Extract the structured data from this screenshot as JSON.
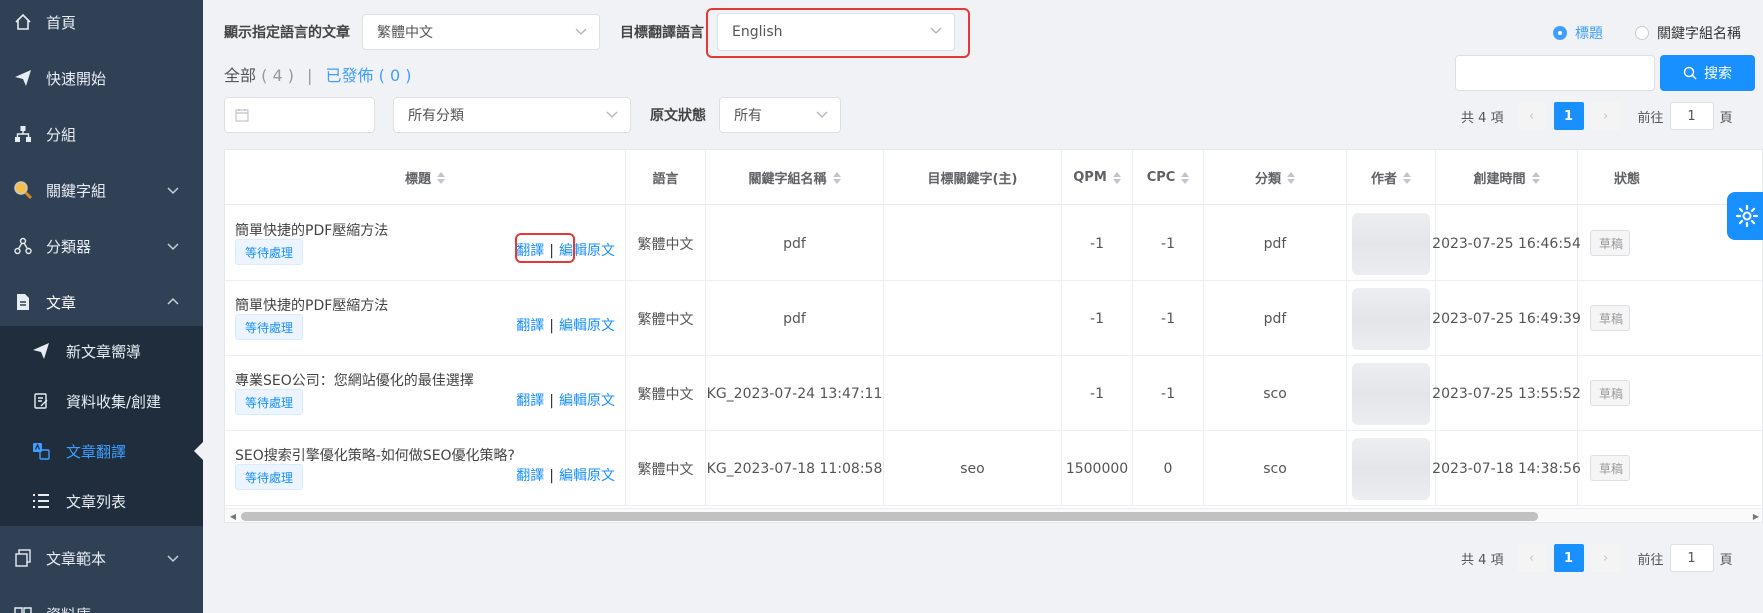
{
  "sidebar": {
    "items": [
      {
        "label": "首頁",
        "icon": "home-icon"
      },
      {
        "label": "快速開始",
        "icon": "paper-plane-icon"
      },
      {
        "label": "分組",
        "icon": "sitemap-icon"
      },
      {
        "label": "關鍵字組",
        "icon": "magnifier-icon"
      },
      {
        "label": "分類器",
        "icon": "share-nodes-icon"
      },
      {
        "label": "文章",
        "icon": "document-icon"
      },
      {
        "label": "文章範本",
        "icon": "copy-icon"
      },
      {
        "label": "資料庫",
        "icon": "book-icon"
      }
    ],
    "article_sub": [
      {
        "label": "新文章嚮導",
        "icon": "paper-plane-icon"
      },
      {
        "label": "資料收集/創建",
        "icon": "clipboard-edit-icon"
      },
      {
        "label": "文章翻譯",
        "icon": "translate-icon"
      },
      {
        "label": "文章列表",
        "icon": "list-icon"
      }
    ]
  },
  "filters": {
    "show_lang_label": "顯示指定語言的文章",
    "show_lang_value": "繁體中文",
    "target_lang_label": "目標翻譯語言",
    "target_lang_value": "English",
    "category_value": "所有分類",
    "status_label": "原文狀態",
    "status_value": "所有"
  },
  "search": {
    "radio_title": "標題",
    "radio_keyword_group": "關鍵字組名稱",
    "button": "搜索"
  },
  "counts": {
    "all_label": "全部",
    "all_count": "( 4 )",
    "divider": "|",
    "published_label": "已發佈",
    "published_count": "( 0 )"
  },
  "pagination": {
    "total": "共 4 項",
    "current": "1",
    "goto_prefix": "前往",
    "goto_value": "1",
    "goto_suffix": "頁"
  },
  "table": {
    "headers": {
      "title": "標題",
      "language": "語言",
      "keyword_group": "關鍵字組名稱",
      "target_keyword": "目標關鍵字(主)",
      "qpm": "QPM",
      "cpc": "CPC",
      "category": "分類",
      "author": "作者",
      "created": "創建時間",
      "status": "狀態"
    },
    "action_translate": "翻譯",
    "action_edit": "編輯原文",
    "action_sep": "|",
    "rows": [
      {
        "title": "簡單快捷的PDF壓縮方法",
        "tag": "等待處理",
        "language": "繁體中文",
        "keyword_group": "pdf",
        "target_keyword": "",
        "qpm": "-1",
        "cpc": "-1",
        "category": "pdf",
        "created": "2023-07-25 16:46:54",
        "status": "草稿"
      },
      {
        "title": "簡單快捷的PDF壓縮方法",
        "tag": "等待處理",
        "language": "繁體中文",
        "keyword_group": "pdf",
        "target_keyword": "",
        "qpm": "-1",
        "cpc": "-1",
        "category": "pdf",
        "created": "2023-07-25 16:49:39",
        "status": "草稿"
      },
      {
        "title": "專業SEO公司：您網站優化的最佳選擇",
        "tag": "等待處理",
        "language": "繁體中文",
        "keyword_group": "KG_2023-07-24 13:47:11",
        "target_keyword": "",
        "qpm": "-1",
        "cpc": "-1",
        "category": "sco",
        "created": "2023-07-25 13:55:52",
        "status": "草稿"
      },
      {
        "title": "SEO搜索引擎優化策略-如何做SEO優化策略?",
        "tag": "等待處理",
        "language": "繁體中文",
        "keyword_group": "KG_2023-07-18 11:08:58",
        "target_keyword": "seo",
        "qpm": "1500000",
        "cpc": "0",
        "category": "sco",
        "created": "2023-07-18 14:38:56",
        "status": "草稿"
      }
    ]
  },
  "colors": {
    "sidebar_bg": "#304156",
    "submenu_bg": "#1f2d3d",
    "accent": "#1890ff",
    "highlight": "#e53935"
  }
}
